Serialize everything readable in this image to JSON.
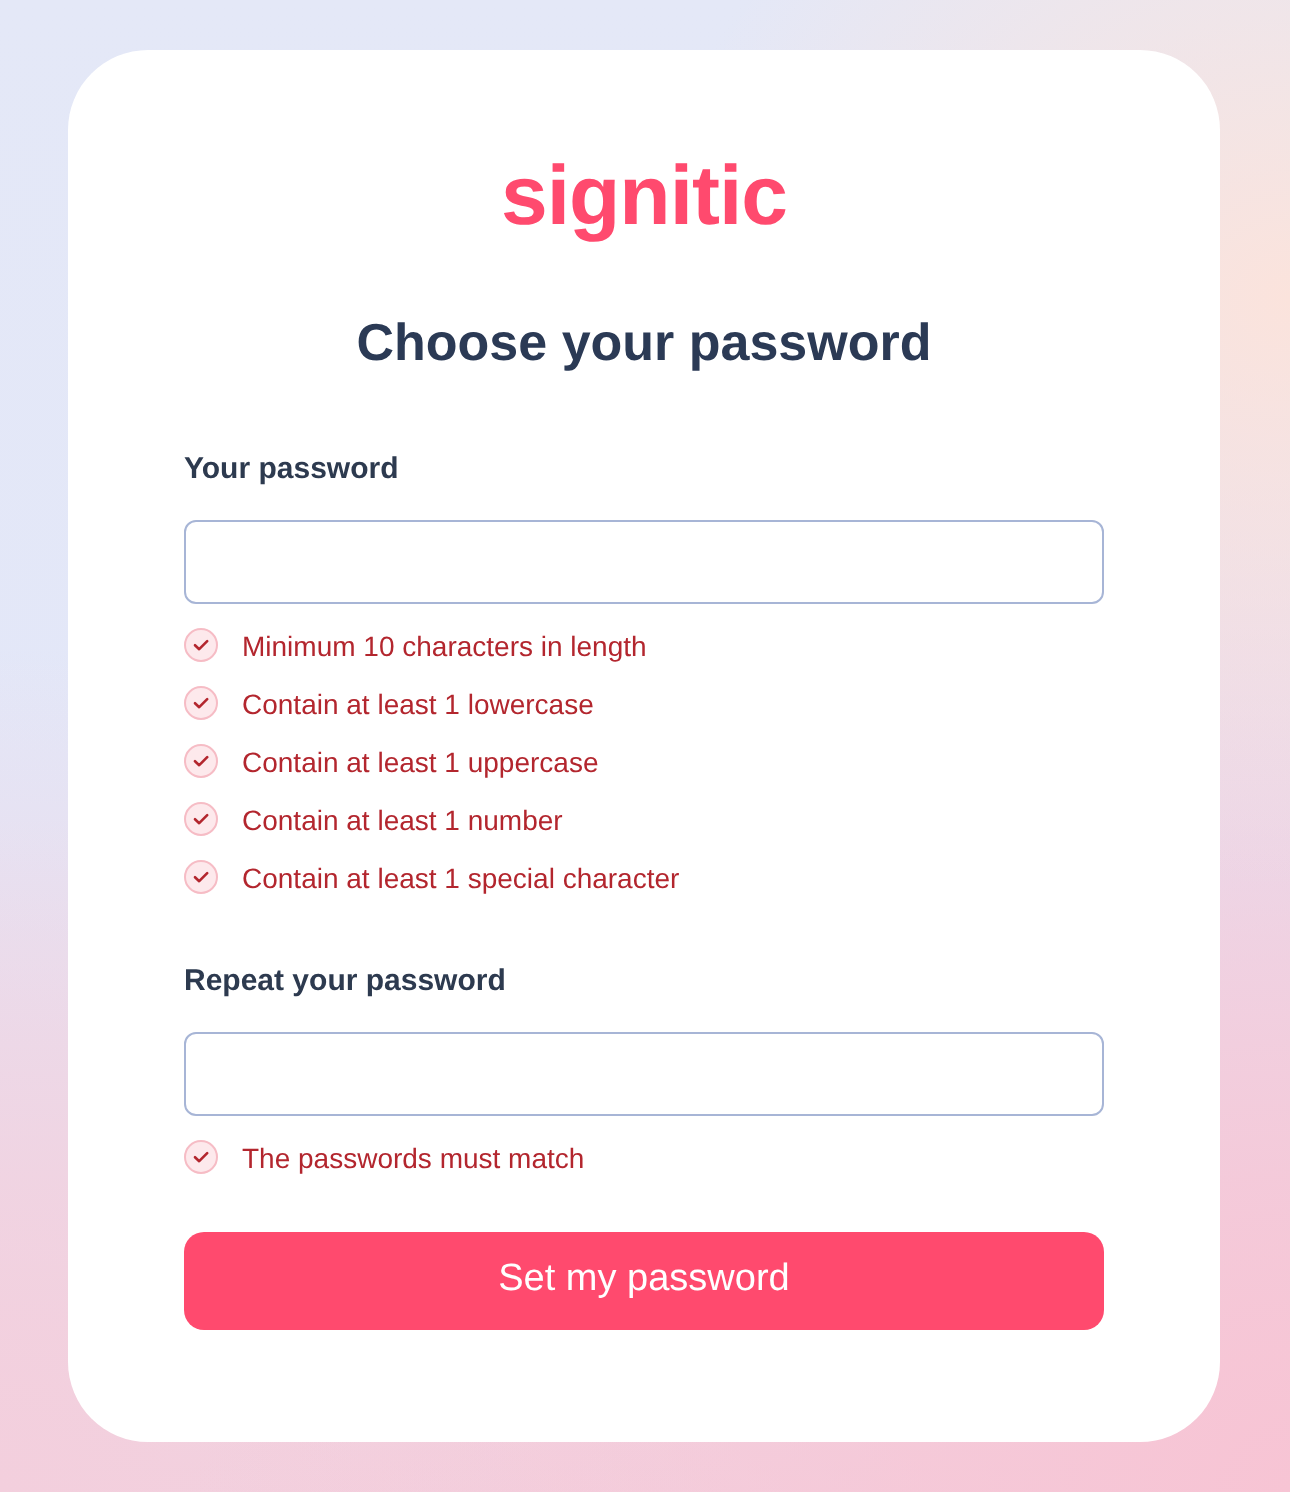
{
  "logo": {
    "text": "signitic"
  },
  "title": "Choose your password",
  "fields": [
    {
      "label": "Your password",
      "requirements": [
        {
          "text": "Minimum 10 characters in length",
          "met": false
        },
        {
          "text": "Contain at least 1 lowercase",
          "met": false
        },
        {
          "text": "Contain at least 1 uppercase",
          "met": false
        },
        {
          "text": "Contain at least 1 number",
          "met": false
        },
        {
          "text": "Contain at least 1 special character",
          "met": false
        }
      ]
    },
    {
      "label": "Repeat your password",
      "requirements": [
        {
          "text": "The passwords must match",
          "met": false
        }
      ]
    }
  ],
  "button": {
    "label": "Set my password"
  }
}
